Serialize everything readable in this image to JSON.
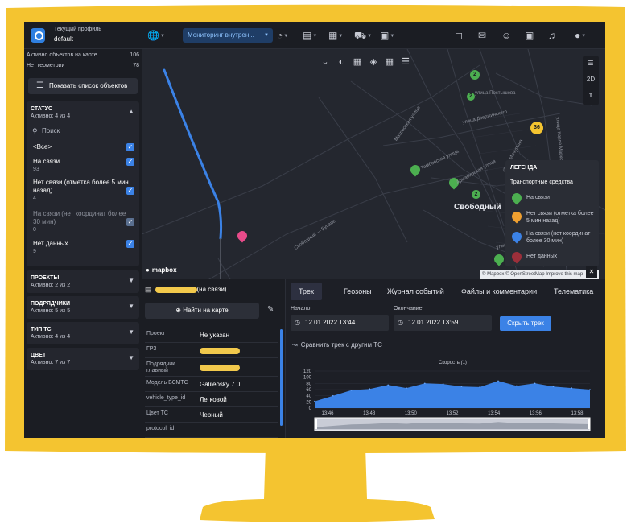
{
  "header": {
    "profile_caption": "Текущий профиль",
    "profile_value": "default",
    "monitoring_select": "Мониторинг внутрен..."
  },
  "sidebar": {
    "stats": [
      {
        "label": "Активно объектов на карте",
        "value": "106"
      },
      {
        "label": "Нет геометрии",
        "value": "78"
      }
    ],
    "show_list_button": "Показать список объектов",
    "status_panel": {
      "title": "СТАТУС",
      "subtitle": "Активно: 4 из 4",
      "search_placeholder": "Поиск",
      "options": [
        {
          "label": "<Все>",
          "count": "",
          "checked": true
        },
        {
          "label": "На связи",
          "count": "93",
          "checked": true
        },
        {
          "label": "Нет связи (отметка более 5 мин назад)",
          "count": "4",
          "checked": true
        },
        {
          "label": "На связи (нет координат более 30 мин)",
          "count": "0",
          "checked": true
        },
        {
          "label": "Нет данных",
          "count": "9",
          "checked": true
        }
      ]
    },
    "panels": [
      {
        "title": "ПРОЕКТЫ",
        "subtitle": "Активно: 2 из 2"
      },
      {
        "title": "ПОДРЯДЧИКИ",
        "subtitle": "Активно: 5 из 5"
      },
      {
        "title": "ТИП ТС",
        "subtitle": "Активно: 4 из 4"
      },
      {
        "title": "ЦВЕТ",
        "subtitle": "Активно: 7 из 7"
      }
    ]
  },
  "map": {
    "clusters": [
      "2",
      "2",
      "36",
      "2",
      "2"
    ],
    "streets": [
      "улица Постышева",
      "улица Дзержинского",
      "Матросская улица",
      "Тамбовская улица",
      "Армавирская улица",
      "Свободный — Бусаре",
      "улица Кручинина",
      "улица Мичурина",
      "улица Карла Маркса"
    ],
    "district": "Свободный",
    "legend": {
      "title": "ЛЕГЕНДА",
      "subtitle": "Транспортные средства",
      "items": [
        {
          "label": "На связи",
          "color": "#4caf50"
        },
        {
          "label": "Нет связи (отметка более 5 мин назад)",
          "color": "#f0a030"
        },
        {
          "label": "На связи (нет координат более 30 мин)",
          "color": "#3b82e6"
        },
        {
          "label": "Нет данных",
          "color": "#9c2f3a"
        }
      ]
    },
    "zoom_mode": "2D",
    "brand": "mapbox",
    "attribution": "© Mapbox © OpenStreetMap Improve this map"
  },
  "vehicle": {
    "status_suffix": "(на связи)",
    "find_button": "Найти на карте",
    "rows": [
      {
        "key": "Проект",
        "value": "Не указан"
      },
      {
        "key": "ГРЗ",
        "value": ""
      },
      {
        "key": "Подрядчик главный",
        "value": ""
      },
      {
        "key": "Модель БСМТС",
        "value": "Galileosky 7.0"
      },
      {
        "key": "vehicle_type_id",
        "value": "Легковой"
      },
      {
        "key": "Цвет ТС",
        "value": "Черный"
      },
      {
        "key": "protocol_id",
        "value": ""
      }
    ]
  },
  "track": {
    "tabs": [
      "Трек",
      "Геозоны",
      "Журнал событий",
      "Файлы и комментарии",
      "Телематика"
    ],
    "start_caption": "Начало",
    "start_value": "12.01.2022 13:44",
    "end_caption": "Окончание",
    "end_value": "12.01.2022 13:59",
    "hide_button": "Скрыть трек",
    "compare_label": "Сравнить трек с другим ТС"
  },
  "chart_data": {
    "type": "area",
    "title": "Скорость (1)",
    "xlabel": "",
    "ylabel": "",
    "ylim": [
      0,
      120
    ],
    "yticks": [
      0,
      20,
      40,
      60,
      80,
      100,
      120
    ],
    "xticks": [
      "13:46",
      "13:48",
      "13:50",
      "13:52",
      "13:54",
      "13:56",
      "13:58"
    ],
    "x": [
      "13:44",
      "13:45",
      "13:46",
      "13:47",
      "13:48",
      "13:49",
      "13:50",
      "13:51",
      "13:52",
      "13:53",
      "13:54",
      "13:55",
      "13:56",
      "13:57",
      "13:58",
      "13:59"
    ],
    "values": [
      22,
      40,
      58,
      62,
      75,
      65,
      80,
      78,
      70,
      68,
      88,
      72,
      80,
      70,
      65,
      60
    ],
    "color": "#3b82e6"
  }
}
